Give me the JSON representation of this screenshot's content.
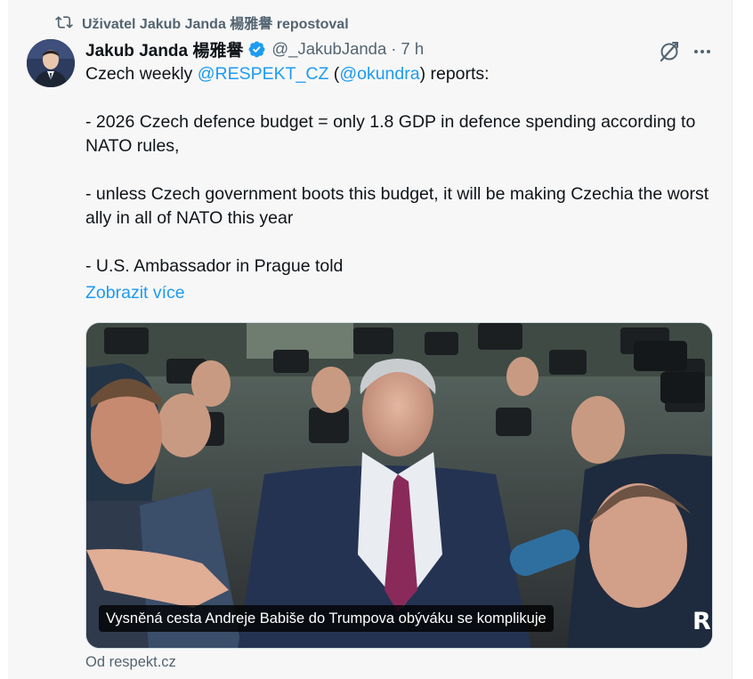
{
  "repost": {
    "icon": "repost-icon",
    "text": "Uživatel Jakub Janda 楊雅譽 repostoval"
  },
  "author": {
    "display_name": "Jakub Janda 楊雅譽",
    "verified_icon": "verified-badge-icon",
    "handle": "@_JakubJanda",
    "separator": "·",
    "time": "7 h"
  },
  "actions": {
    "grok_icon": "grok-icon",
    "more_icon": "more-icon"
  },
  "tweet": {
    "intro_prefix": "Czech weekly ",
    "mention_1": "@RESPEKT_CZ",
    "paren_open": " (",
    "mention_2": "@okundra",
    "paren_close_suffix": ") reports:",
    "bullet_1": "- 2026 Czech defence budget = only 1.8 GDP in defence spending according to NATO rules,",
    "bullet_2": "- unless Czech government boots this budget, it will be making Czechia the worst ally in all of NATO this year",
    "bullet_3": "- U.S. Ambassador in Prague told",
    "show_more": "Zobrazit více"
  },
  "card": {
    "caption": "Vysněná cesta Andreje Babiše do Trumpova obýváku se komplikuje",
    "brand_mark": "R"
  },
  "source": "Od respekt.cz",
  "colors": {
    "link": "#1d9bf0",
    "muted": "#536471",
    "verified": "#1d9bf0",
    "background": "#f7f7f7"
  }
}
